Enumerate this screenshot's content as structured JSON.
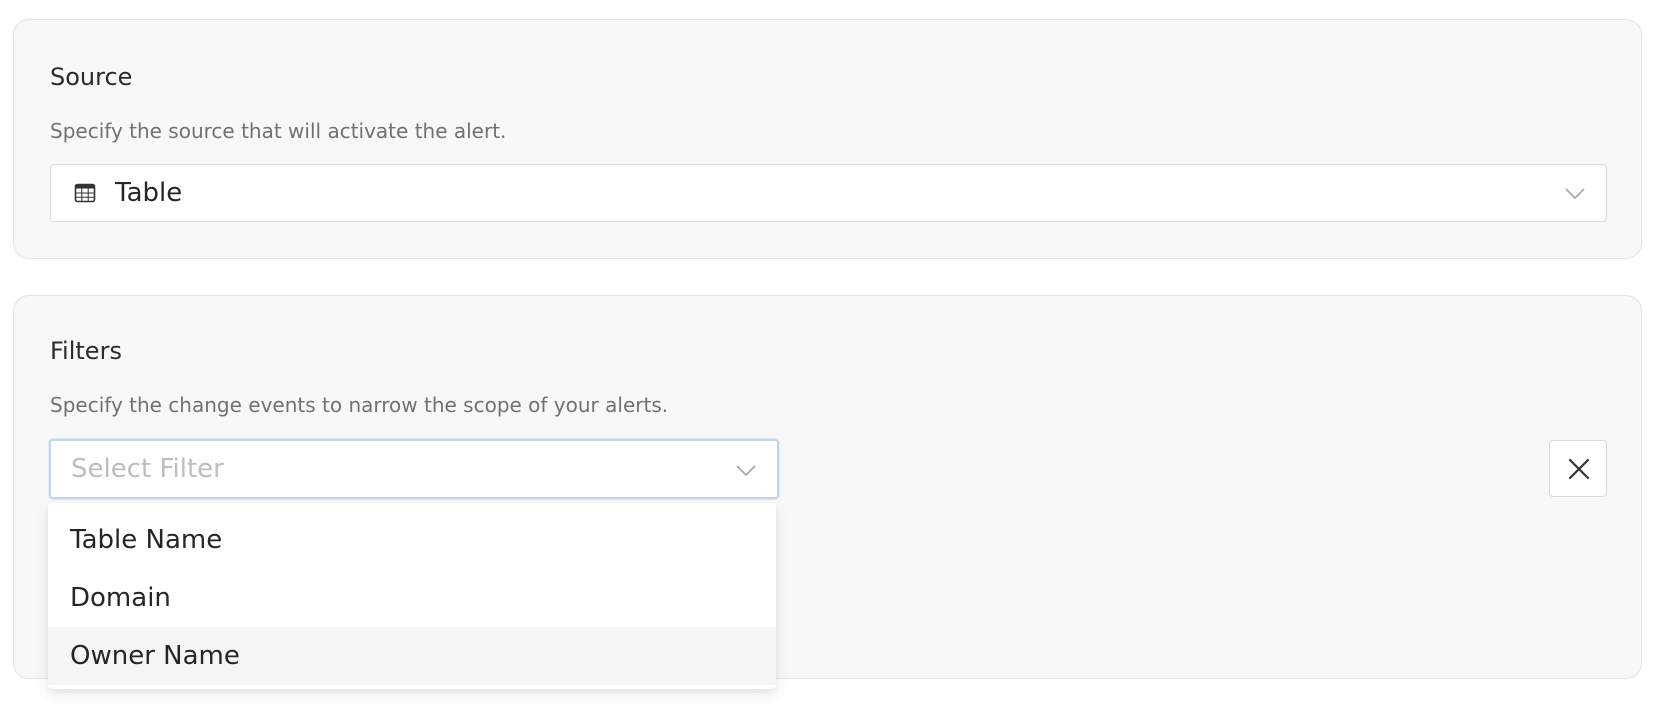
{
  "source": {
    "title": "Source",
    "description": "Specify the source that will activate the alert.",
    "select": {
      "value": "Table",
      "icon": "table-icon"
    }
  },
  "filters": {
    "title": "Filters",
    "description": "Specify the change events to narrow the scope of your alerts.",
    "select": {
      "placeholder": "Select Filter",
      "focused": true
    },
    "remove_icon": "close-icon",
    "dropdown": {
      "options": [
        {
          "label": "Table Name",
          "active": false
        },
        {
          "label": "Domain",
          "active": false
        },
        {
          "label": "Owner Name",
          "active": true
        }
      ]
    }
  },
  "colors": {
    "card_background": "#f8f8f8",
    "card_border": "#e3e3e3",
    "focus_border": "#c2d5ef",
    "active_option_background": "#f5f5f5",
    "placeholder_text": "#bdbdbd",
    "description_text": "#717171"
  }
}
